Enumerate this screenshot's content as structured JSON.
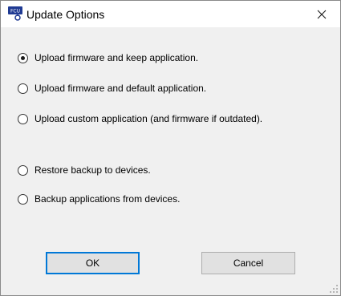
{
  "window": {
    "title": "Update Options",
    "icon_text": "FCU"
  },
  "options": [
    {
      "label": "Upload firmware and keep application.",
      "checked": true
    },
    {
      "label": "Upload firmware and default application.",
      "checked": false
    },
    {
      "label": "Upload custom application (and firmware if outdated).",
      "checked": false
    },
    {
      "label": "Restore backup to devices.",
      "checked": false
    },
    {
      "label": "Backup applications from devices.",
      "checked": false
    }
  ],
  "buttons": {
    "ok_label": "OK",
    "cancel_label": "Cancel"
  },
  "colors": {
    "accent": "#0078d7",
    "icon_badge": "#1f3a93"
  }
}
